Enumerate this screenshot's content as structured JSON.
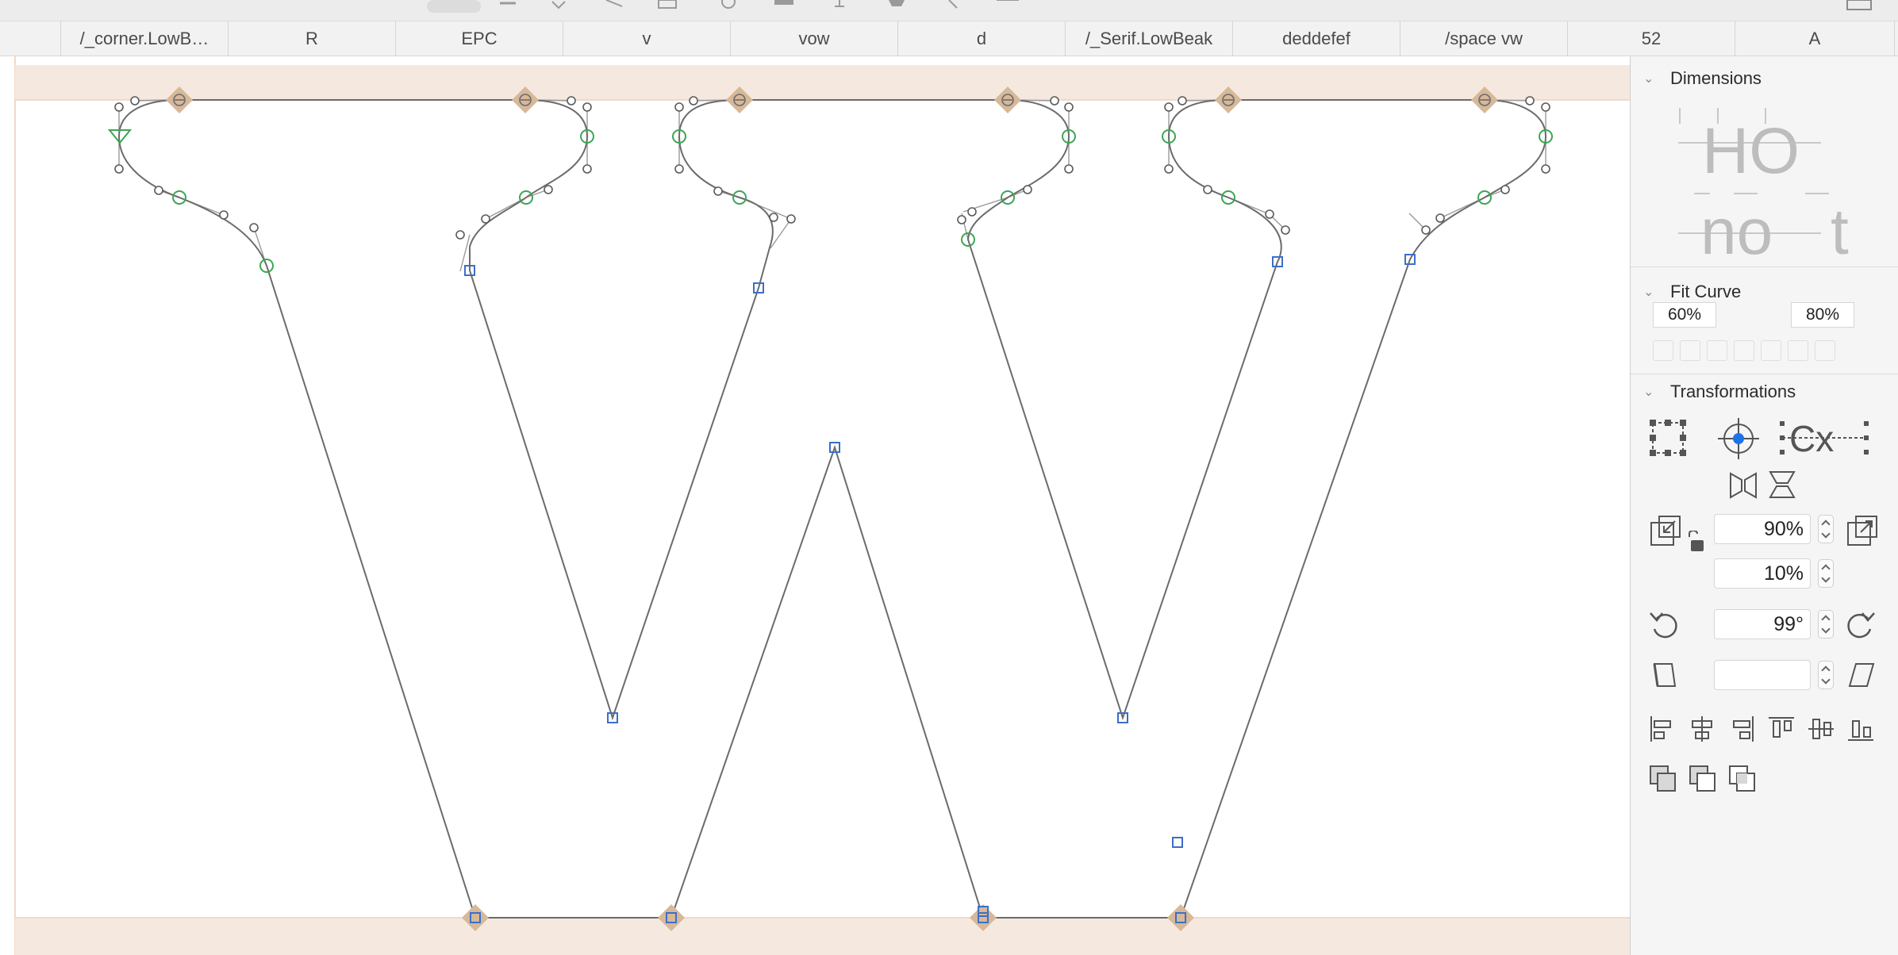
{
  "tabs": [
    "/_corner.LowB…",
    "R",
    "EPC",
    "v",
    "vow",
    "d",
    "/_Serif.LowBeak",
    "deddefef",
    "/space vw",
    "52",
    "A"
  ],
  "panel": {
    "dimensions": {
      "title": "Dimensions",
      "preview_top": "HO",
      "preview_bottom_left": "no",
      "preview_bottom_right": "t"
    },
    "fit_curve": {
      "title": "Fit Curve",
      "min": "60%",
      "max": "80%"
    },
    "transformations": {
      "title": "Transformations",
      "scale": "90%",
      "scale_y": "10%",
      "rotate": "99°",
      "slant": ""
    }
  },
  "icons": {
    "canvas": [
      "start-point-icon"
    ],
    "transform": [
      "bounding-box-icon",
      "origin-crosshair-icon",
      "metrics-origin-icon",
      "mirror-horizontal-icon",
      "mirror-vertical-icon",
      "scale-down-icon",
      "lock-icon",
      "scale-up-icon",
      "rotate-ccw-icon",
      "rotate-cw-icon",
      "slant-left-icon",
      "slant-right-icon",
      "align-left-icon",
      "align-center-icon",
      "align-right-icon",
      "align-top-icon",
      "align-middle-icon",
      "align-bottom-icon",
      "union-icon",
      "subtract-icon",
      "intersect-icon"
    ]
  },
  "colors": {
    "accent": "#1a73e8",
    "metric_band": "#f5e9df",
    "node_diamond": "#d7b899",
    "smooth_node": "#3aa655",
    "corner_node": "#3b6fc9"
  }
}
